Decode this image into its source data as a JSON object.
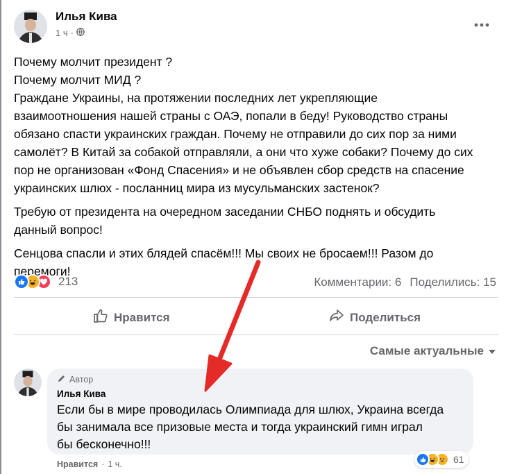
{
  "post": {
    "author": "Илья Кива",
    "time": "1 ч",
    "time_sep": "·",
    "paragraphs": [
      [
        "Почему молчит президент ?",
        "Почему молчит МИД ?",
        "Граждане Украины, на протяжении последних лет укрепляющие",
        "взаимоотношения  нашей страны с ОАЭ, попали в беду! Руководство страны",
        "обязано спасти украинских граждан. Почему не отправили до сих пор за ними",
        "самолёт? В Китай за собакой отправляли, а они что хуже собаки? Почему до сих",
        "пор не организован «Фонд Спасения» и  не объявлен сбор средств на спасение",
        "украинских шлюх - посланниц мира из мусульманских застенок?"
      ],
      [
        "Требую от президента на очередном заседании СНБО поднять и обсудить",
        "данный вопрос!"
      ],
      [
        "Сенцова спасли и этих блядей спасём!!! Мы своих не бросаем!!! Разом до",
        "перемоги!"
      ]
    ],
    "reaction_count": "213",
    "comments_label": "Комментарии: 6",
    "shares_label": "Поделились: 15"
  },
  "actions": {
    "like_label": "Нравится",
    "share_label": "Поделиться"
  },
  "sort": {
    "label": "Самые актуальные"
  },
  "comment": {
    "badge": "Автор",
    "author": "Илья Кива",
    "lines": [
      "Если бы в мире проводилась Олимпиада для шлюх, Украина всегда",
      "бы занимала все призовые места и тогда украинский гимн играл",
      "бы бесконечно!!!"
    ],
    "reaction_count": "61",
    "like_label": "Нравится",
    "sep": "·",
    "time": "1 ч."
  },
  "icons": {
    "globe": "globe-icon",
    "more": "more-options-icon",
    "like": "thumbs-up-icon",
    "share": "share-arrow-icon",
    "sort": "caret-down-icon",
    "pencil": "pencil-icon",
    "reactions": [
      "like-reaction-icon",
      "haha-reaction-icon",
      "love-reaction-icon"
    ],
    "annotation_arrow": "red-arrow-icon"
  },
  "colors": {
    "like_blue": "#1877f2",
    "love_red": "#f33e58",
    "haha_yellow": "#f7b125",
    "arrow_red": "#e52b27",
    "muted": "#65676b"
  }
}
